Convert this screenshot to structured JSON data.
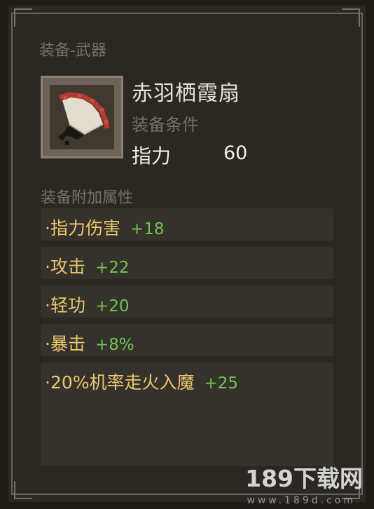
{
  "header": {
    "category": "装备-武器"
  },
  "item": {
    "name": "赤羽栖霞扇",
    "icon": "feather-fan-icon",
    "requirement_title": "装备条件",
    "requirement_stat": "指力",
    "requirement_value": "60"
  },
  "attributes": {
    "title": "装备附加属性",
    "rows": [
      {
        "label": "·指力伤害",
        "value": "+18"
      },
      {
        "label": "·攻击",
        "value": "+22"
      },
      {
        "label": "·轻功",
        "value": "+20"
      },
      {
        "label": "·暴击",
        "value": "+8%"
      },
      {
        "label": "·20%机率走火入魔",
        "value": "+25"
      }
    ]
  },
  "watermark": {
    "text": "189下载网",
    "sub": "www.189d.com"
  },
  "colors": {
    "label": "#ecc76a",
    "bonus": "#6ec64e",
    "panel": "#2b2824"
  }
}
